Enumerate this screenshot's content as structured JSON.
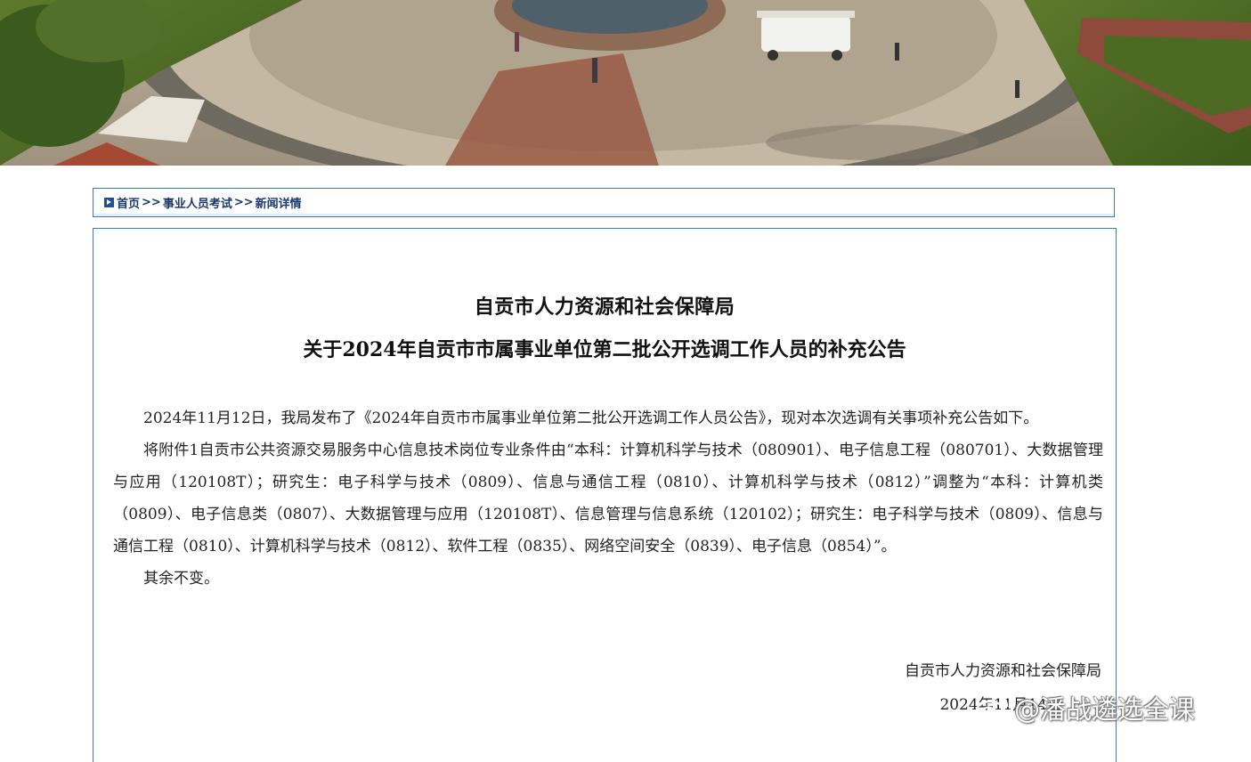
{
  "breadcrumb": {
    "home": "首页",
    "sep": ">>",
    "level2": "事业人员考试",
    "level3": "新闻详情"
  },
  "article": {
    "title_line1": "自贡市人力资源和社会保障局",
    "title_line2": "关于2024年自贡市市属事业单位第二批公开选调工作人员的补充公告",
    "paragraphs": [
      "2024年11月12日，我局发布了《2024年自贡市市属事业单位第二批公开选调工作人员公告》，现对本次选调有关事项补充公告如下。",
      "将附件1自贡市公共资源交易服务中心信息技术岗位专业条件由“本科：计算机科学与技术（080901）、电子信息工程（080701）、大数据管理与应用（120108T）；研究生：电子科学与技术（0809）、信息与通信工程（0810）、计算机科学与技术（0812）”调整为“本科：计算机类（0809）、电子信息类（0807）、大数据管理与应用（120108T）、信息管理与信息系统（120102）；研究生：电子科学与技术（0809）、信息与通信工程（0810）、计算机科学与技术（0812）、软件工程（0835）、网络空间安全（0839）、电子信息（0854）”。",
      "其余不变。"
    ],
    "signature_org": "自贡市人力资源和社会保障局",
    "signature_date": "2024年11月14日"
  },
  "watermark": {
    "text": "@潘战遴选全课",
    "icon": "weibo-icon"
  },
  "colors": {
    "border": "#3e79b8",
    "breadcrumb_text": "#1a3a6e"
  }
}
